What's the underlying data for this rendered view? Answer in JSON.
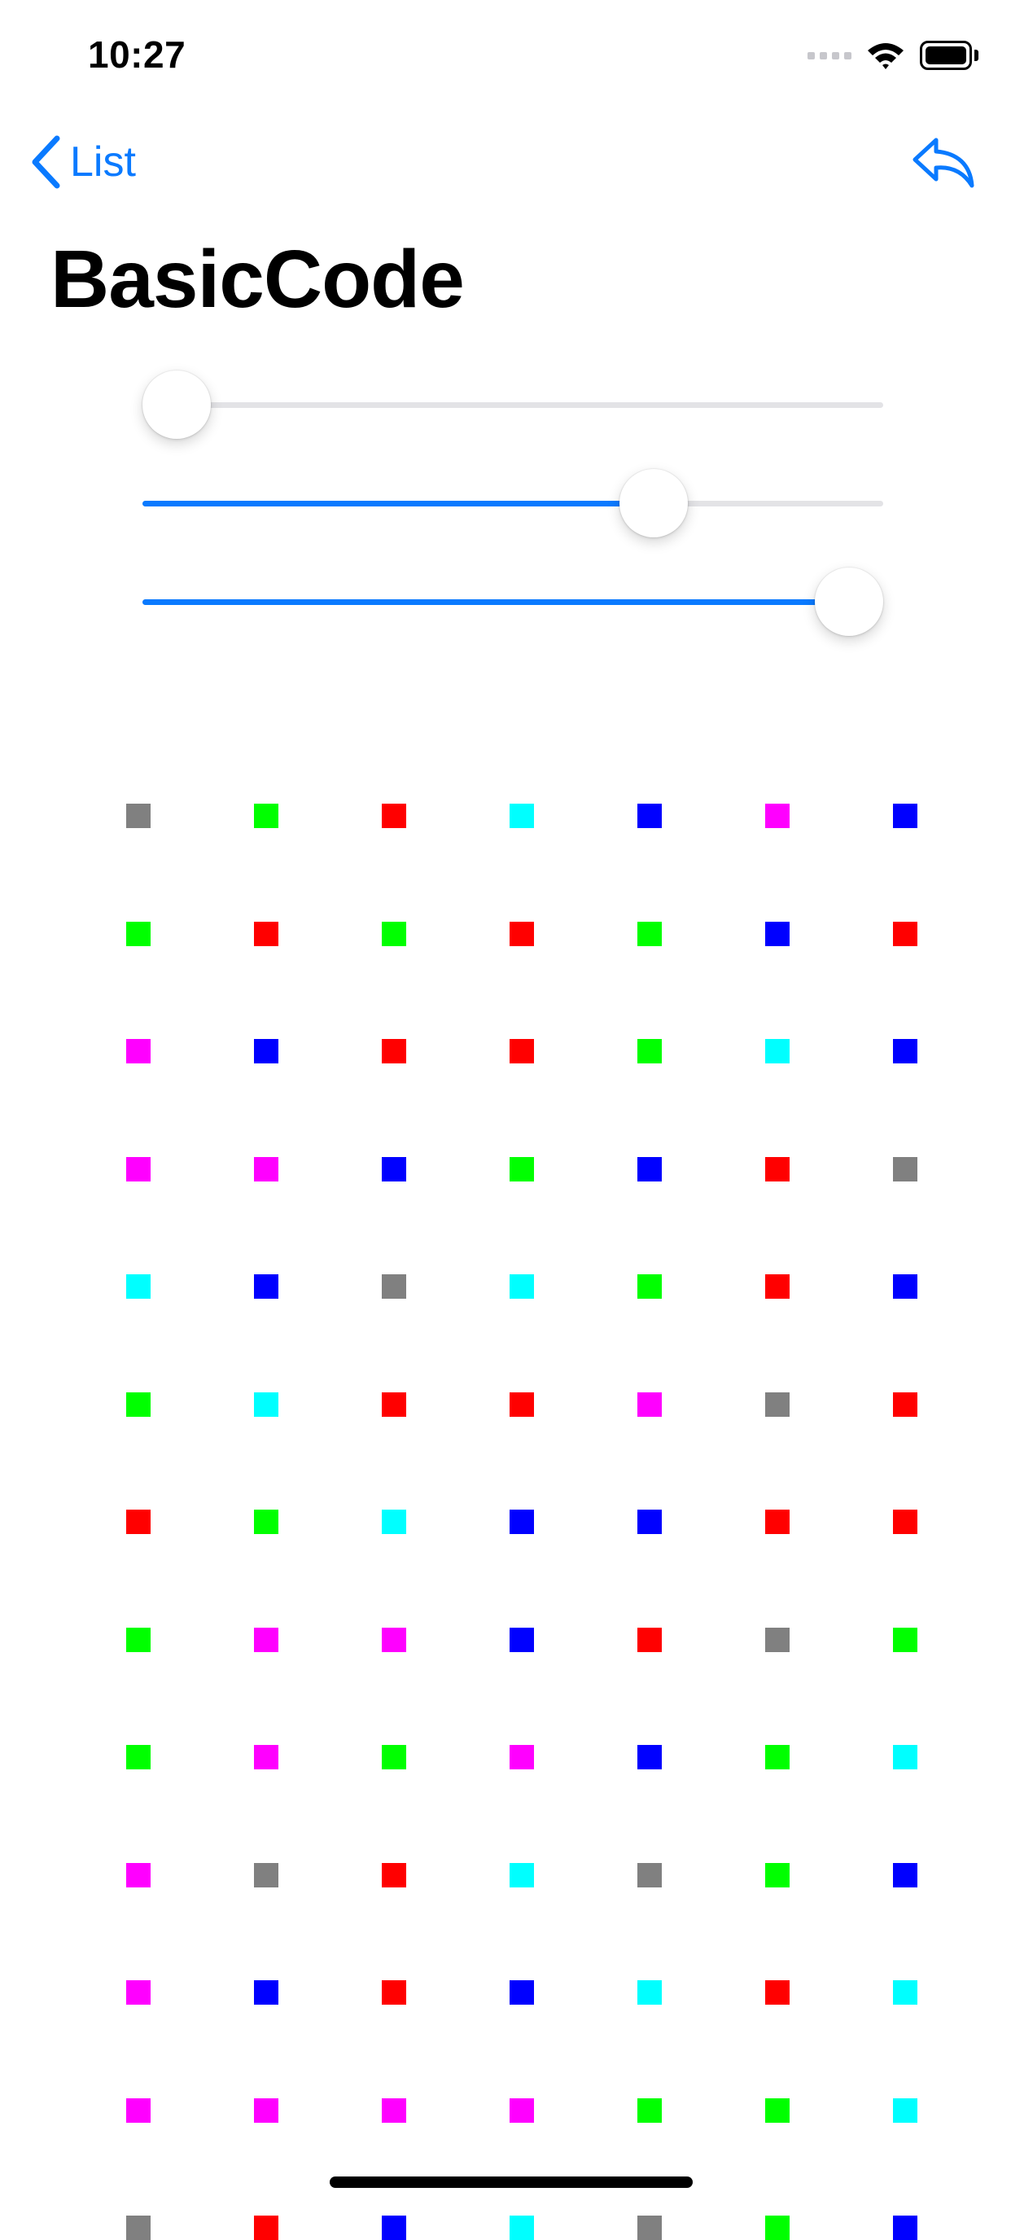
{
  "status_bar": {
    "time": "10:27",
    "icons": [
      "signal-dots-icon",
      "wifi-icon",
      "battery-icon"
    ]
  },
  "nav": {
    "back_label": "List",
    "back_icon": "chevron-left-icon",
    "action_icon": "reply-arrow-icon",
    "accent_color": "#0a7aff"
  },
  "title": "BasicCode",
  "sliders": [
    {
      "value": 0.0
    },
    {
      "value": 0.71
    },
    {
      "value": 1.0
    }
  ],
  "palette": {
    "gray": "#808080",
    "green": "#00ff00",
    "red": "#ff0000",
    "cyan": "#00ffff",
    "blue": "#0000ff",
    "magenta": "#ff00ff"
  },
  "grid": {
    "columns": 7,
    "rows": [
      [
        "gray",
        "green",
        "red",
        "cyan",
        "blue",
        "magenta",
        "blue"
      ],
      [
        "green",
        "red",
        "green",
        "red",
        "green",
        "blue",
        "red"
      ],
      [
        "magenta",
        "blue",
        "red",
        "red",
        "green",
        "cyan",
        "blue"
      ],
      [
        "magenta",
        "magenta",
        "blue",
        "green",
        "blue",
        "red",
        "gray"
      ],
      [
        "cyan",
        "blue",
        "gray",
        "cyan",
        "green",
        "red",
        "blue"
      ],
      [
        "green",
        "cyan",
        "red",
        "red",
        "magenta",
        "gray",
        "red"
      ],
      [
        "red",
        "green",
        "cyan",
        "blue",
        "blue",
        "red",
        "red"
      ],
      [
        "green",
        "magenta",
        "magenta",
        "blue",
        "red",
        "gray",
        "green"
      ],
      [
        "green",
        "magenta",
        "green",
        "magenta",
        "blue",
        "green",
        "cyan"
      ],
      [
        "magenta",
        "gray",
        "red",
        "cyan",
        "gray",
        "green",
        "blue"
      ],
      [
        "magenta",
        "blue",
        "red",
        "blue",
        "cyan",
        "red",
        "cyan"
      ],
      [
        "magenta",
        "magenta",
        "magenta",
        "magenta",
        "green",
        "green",
        "cyan"
      ],
      [
        "gray",
        "red",
        "blue",
        "cyan",
        "gray",
        "green",
        "blue"
      ]
    ]
  }
}
